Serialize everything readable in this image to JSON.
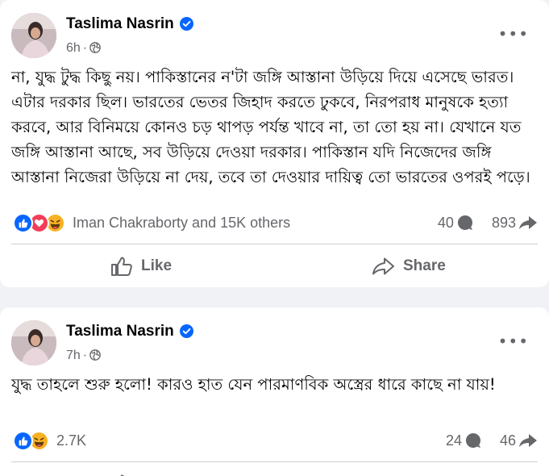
{
  "posts": [
    {
      "author": "Taslima Nasrin",
      "time": "6h",
      "separator": "·",
      "text": "না, যুদ্ধ টুদ্ধ কিছু নয়। পাকিস্তানের ন'টা জঙ্গি আস্তানা উড়িয়ে দিয়ে এসেছে ভারত। এটার দরকার ছিল। ভারতের ভেতর জিহাদ করতে ঢুকবে, নিরপরাধ মানুষকে হত্যা করবে, আর বিনিময়ে কোনও চড় থাপড় পর্যন্ত খাবে না, তা তো হয় না। যেখানে যত জঙ্গি আস্তানা আছে, সব উড়িয়ে দেওয়া দরকার। পাকিস্তান যদি নিজেদের জঙ্গি আস্তানা নিজেরা উড়িয়ে না দেয়, তবে তা দেওয়ার দায়িত্ব তো ভারতের ওপরই পড়ে।",
      "reaction_summary": "Iman Chakraborty and 15K others",
      "comments": "40",
      "shares": "893",
      "actions": {
        "like": "Like",
        "share": "Share"
      }
    },
    {
      "author": "Taslima Nasrin",
      "time": "7h",
      "separator": "·",
      "text": "যুদ্ধ তাহলে শুরু হলো! কারও হাত যেন পারমাণবিক অস্ত্রের ধারে কাছে না যায়!",
      "reaction_summary": "2.7K",
      "comments": "24",
      "shares": "46"
    }
  ],
  "more_glyph": "•••",
  "colors": {
    "accent": "#0866ff",
    "secondary_text": "#65676b",
    "love": "#f33e58",
    "haha": "#f7b125"
  },
  "icons": [
    "verified-badge-icon",
    "globe-icon",
    "like-reaction-icon",
    "love-reaction-icon",
    "haha-reaction-icon",
    "comment-icon",
    "share-icon",
    "thumbs-up-icon",
    "share-arrow-icon"
  ]
}
